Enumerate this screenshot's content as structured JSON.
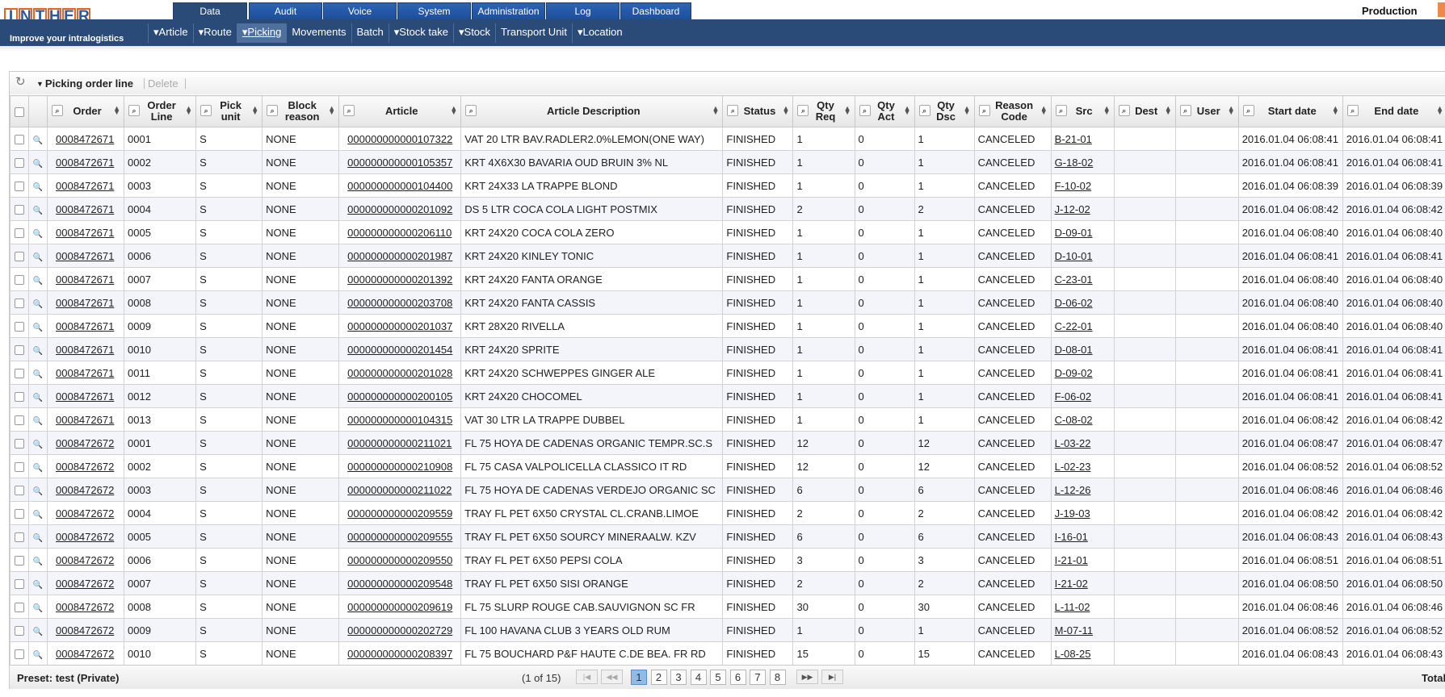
{
  "app": {
    "logo_letters": [
      "I",
      "N",
      "T",
      "H",
      "E",
      "R"
    ],
    "tagline": "Improve your intralogistics",
    "environment": "Production"
  },
  "main_tabs": [
    {
      "label": "Data",
      "active": true
    },
    {
      "label": "Audit"
    },
    {
      "label": "Voice"
    },
    {
      "label": "System"
    },
    {
      "label": "Administration"
    },
    {
      "label": "Log"
    },
    {
      "label": "Dashboard"
    }
  ],
  "sub_menu": [
    {
      "label": "▾Article"
    },
    {
      "label": "▾Route"
    },
    {
      "label": "▾Picking",
      "active": true
    },
    {
      "label": "Movements"
    },
    {
      "label": "Batch"
    },
    {
      "label": "▾Stock take"
    },
    {
      "label": "▾Stock"
    },
    {
      "label": "Transport Unit"
    },
    {
      "label": "▾Location"
    }
  ],
  "panel": {
    "title": "Picking order line",
    "delete_label": "Delete"
  },
  "columns": [
    {
      "key": "order",
      "label": "Order"
    },
    {
      "key": "line",
      "label": "Order Line"
    },
    {
      "key": "pick_unit",
      "label": "Pick unit"
    },
    {
      "key": "block_reason",
      "label": "Block reason"
    },
    {
      "key": "article",
      "label": "Article"
    },
    {
      "key": "description",
      "label": "Article Description"
    },
    {
      "key": "status",
      "label": "Status"
    },
    {
      "key": "qty_req",
      "label": "Qty Req"
    },
    {
      "key": "qty_act",
      "label": "Qty Act"
    },
    {
      "key": "qty_dsc",
      "label": "Qty Dsc"
    },
    {
      "key": "reason_code",
      "label": "Reason Code"
    },
    {
      "key": "src",
      "label": "Src"
    },
    {
      "key": "dest",
      "label": "Dest"
    },
    {
      "key": "user",
      "label": "User"
    },
    {
      "key": "start_date",
      "label": "Start date"
    },
    {
      "key": "end_date",
      "label": "End date"
    }
  ],
  "rows": [
    [
      "0008472671",
      "0001",
      "S",
      "NONE",
      "000000000000107322",
      "VAT 20 LTR BAV.RADLER2.0%LEMON(ONE WAY)",
      "FINISHED",
      "1",
      "0",
      "1",
      "CANCELED",
      "B-21-01",
      "",
      "",
      "2016.01.04 06:08:41",
      "2016.01.04 06:08:41"
    ],
    [
      "0008472671",
      "0002",
      "S",
      "NONE",
      "000000000000105357",
      "KRT 4X6X30 BAVARIA OUD BRUIN 3% NL",
      "FINISHED",
      "1",
      "0",
      "1",
      "CANCELED",
      "G-18-02",
      "",
      "",
      "2016.01.04 06:08:41",
      "2016.01.04 06:08:41"
    ],
    [
      "0008472671",
      "0003",
      "S",
      "NONE",
      "000000000000104400",
      "KRT 24X33 LA TRAPPE BLOND",
      "FINISHED",
      "1",
      "0",
      "1",
      "CANCELED",
      "F-10-02",
      "",
      "",
      "2016.01.04 06:08:39",
      "2016.01.04 06:08:39"
    ],
    [
      "0008472671",
      "0004",
      "S",
      "NONE",
      "000000000000201092",
      "DS 5 LTR COCA COLA LIGHT POSTMIX",
      "FINISHED",
      "2",
      "0",
      "2",
      "CANCELED",
      "J-12-02",
      "",
      "",
      "2016.01.04 06:08:42",
      "2016.01.04 06:08:42"
    ],
    [
      "0008472671",
      "0005",
      "S",
      "NONE",
      "000000000000206110",
      "KRT 24X20 COCA COLA ZERO",
      "FINISHED",
      "1",
      "0",
      "1",
      "CANCELED",
      "D-09-01",
      "",
      "",
      "2016.01.04 06:08:40",
      "2016.01.04 06:08:40"
    ],
    [
      "0008472671",
      "0006",
      "S",
      "NONE",
      "000000000000201987",
      "KRT 24X20 KINLEY TONIC",
      "FINISHED",
      "1",
      "0",
      "1",
      "CANCELED",
      "D-10-01",
      "",
      "",
      "2016.01.04 06:08:41",
      "2016.01.04 06:08:41"
    ],
    [
      "0008472671",
      "0007",
      "S",
      "NONE",
      "000000000000201392",
      "KRT 24X20 FANTA ORANGE",
      "FINISHED",
      "1",
      "0",
      "1",
      "CANCELED",
      "C-23-01",
      "",
      "",
      "2016.01.04 06:08:40",
      "2016.01.04 06:08:40"
    ],
    [
      "0008472671",
      "0008",
      "S",
      "NONE",
      "000000000000203708",
      "KRT 24X20 FANTA CASSIS",
      "FINISHED",
      "1",
      "0",
      "1",
      "CANCELED",
      "D-06-02",
      "",
      "",
      "2016.01.04 06:08:40",
      "2016.01.04 06:08:40"
    ],
    [
      "0008472671",
      "0009",
      "S",
      "NONE",
      "000000000000201037",
      "KRT 28X20 RIVELLA",
      "FINISHED",
      "1",
      "0",
      "1",
      "CANCELED",
      "C-22-01",
      "",
      "",
      "2016.01.04 06:08:40",
      "2016.01.04 06:08:40"
    ],
    [
      "0008472671",
      "0010",
      "S",
      "NONE",
      "000000000000201454",
      "KRT 24X20 SPRITE",
      "FINISHED",
      "1",
      "0",
      "1",
      "CANCELED",
      "D-08-01",
      "",
      "",
      "2016.01.04 06:08:41",
      "2016.01.04 06:08:41"
    ],
    [
      "0008472671",
      "0011",
      "S",
      "NONE",
      "000000000000201028",
      "KRT 24X20 SCHWEPPES GINGER ALE",
      "FINISHED",
      "1",
      "0",
      "1",
      "CANCELED",
      "D-09-02",
      "",
      "",
      "2016.01.04 06:08:41",
      "2016.01.04 06:08:41"
    ],
    [
      "0008472671",
      "0012",
      "S",
      "NONE",
      "000000000000200105",
      "KRT 24X20 CHOCOMEL",
      "FINISHED",
      "1",
      "0",
      "1",
      "CANCELED",
      "F-06-02",
      "",
      "",
      "2016.01.04 06:08:41",
      "2016.01.04 06:08:41"
    ],
    [
      "0008472671",
      "0013",
      "S",
      "NONE",
      "000000000000104315",
      "VAT 30 LTR LA TRAPPE DUBBEL",
      "FINISHED",
      "1",
      "0",
      "1",
      "CANCELED",
      "C-08-02",
      "",
      "",
      "2016.01.04 06:08:42",
      "2016.01.04 06:08:42"
    ],
    [
      "0008472672",
      "0001",
      "S",
      "NONE",
      "000000000000211021",
      "FL 75 HOYA DE CADENAS ORGANIC TEMPR.SC.S",
      "FINISHED",
      "12",
      "0",
      "12",
      "CANCELED",
      "L-03-22",
      "",
      "",
      "2016.01.04 06:08:47",
      "2016.01.04 06:08:47"
    ],
    [
      "0008472672",
      "0002",
      "S",
      "NONE",
      "000000000000210908",
      "FL 75 CASA VALPOLICELLA CLASSICO IT RD",
      "FINISHED",
      "12",
      "0",
      "12",
      "CANCELED",
      "L-02-23",
      "",
      "",
      "2016.01.04 06:08:52",
      "2016.01.04 06:08:52"
    ],
    [
      "0008472672",
      "0003",
      "S",
      "NONE",
      "000000000000211022",
      "FL 75 HOYA DE CADENAS VERDEJO ORGANIC SC",
      "FINISHED",
      "6",
      "0",
      "6",
      "CANCELED",
      "L-12-26",
      "",
      "",
      "2016.01.04 06:08:46",
      "2016.01.04 06:08:46"
    ],
    [
      "0008472672",
      "0004",
      "S",
      "NONE",
      "000000000000209559",
      "TRAY FL PET 6X50 CRYSTAL CL.CRANB.LIMOE",
      "FINISHED",
      "2",
      "0",
      "2",
      "CANCELED",
      "J-19-03",
      "",
      "",
      "2016.01.04 06:08:42",
      "2016.01.04 06:08:42"
    ],
    [
      "0008472672",
      "0005",
      "S",
      "NONE",
      "000000000000209555",
      "TRAY FL PET 6X50 SOURCY MINERAALW. KZV",
      "FINISHED",
      "6",
      "0",
      "6",
      "CANCELED",
      "I-16-01",
      "",
      "",
      "2016.01.04 06:08:43",
      "2016.01.04 06:08:43"
    ],
    [
      "0008472672",
      "0006",
      "S",
      "NONE",
      "000000000000209550",
      "TRAY FL PET 6X50 PEPSI COLA",
      "FINISHED",
      "3",
      "0",
      "3",
      "CANCELED",
      "I-21-01",
      "",
      "",
      "2016.01.04 06:08:51",
      "2016.01.04 06:08:51"
    ],
    [
      "0008472672",
      "0007",
      "S",
      "NONE",
      "000000000000209548",
      "TRAY FL PET 6X50 SISI ORANGE",
      "FINISHED",
      "2",
      "0",
      "2",
      "CANCELED",
      "I-21-02",
      "",
      "",
      "2016.01.04 06:08:50",
      "2016.01.04 06:08:50"
    ],
    [
      "0008472672",
      "0008",
      "S",
      "NONE",
      "000000000000209619",
      "FL 75 SLURP ROUGE CAB.SAUVIGNON SC FR",
      "FINISHED",
      "30",
      "0",
      "30",
      "CANCELED",
      "L-11-02",
      "",
      "",
      "2016.01.04 06:08:46",
      "2016.01.04 06:08:46"
    ],
    [
      "0008472672",
      "0009",
      "S",
      "NONE",
      "000000000000202729",
      "FL 100 HAVANA CLUB 3 YEARS OLD RUM",
      "FINISHED",
      "1",
      "0",
      "1",
      "CANCELED",
      "M-07-11",
      "",
      "",
      "2016.01.04 06:08:52",
      "2016.01.04 06:08:52"
    ],
    [
      "0008472672",
      "0010",
      "S",
      "NONE",
      "000000000000208397",
      "FL 75 BOUCHARD P&F HAUTE C.DE BEA. FR RD",
      "FINISHED",
      "15",
      "0",
      "15",
      "CANCELED",
      "L-08-25",
      "",
      "",
      "2016.01.04 06:08:43",
      "2016.01.04 06:08:43"
    ]
  ],
  "footer": {
    "preset": "Preset: test (Private)",
    "page_info": "(1 of 15)",
    "pages": [
      "1",
      "2",
      "3",
      "4",
      "5",
      "6",
      "7",
      "8"
    ],
    "current_page": "1",
    "total_label": "Total"
  }
}
